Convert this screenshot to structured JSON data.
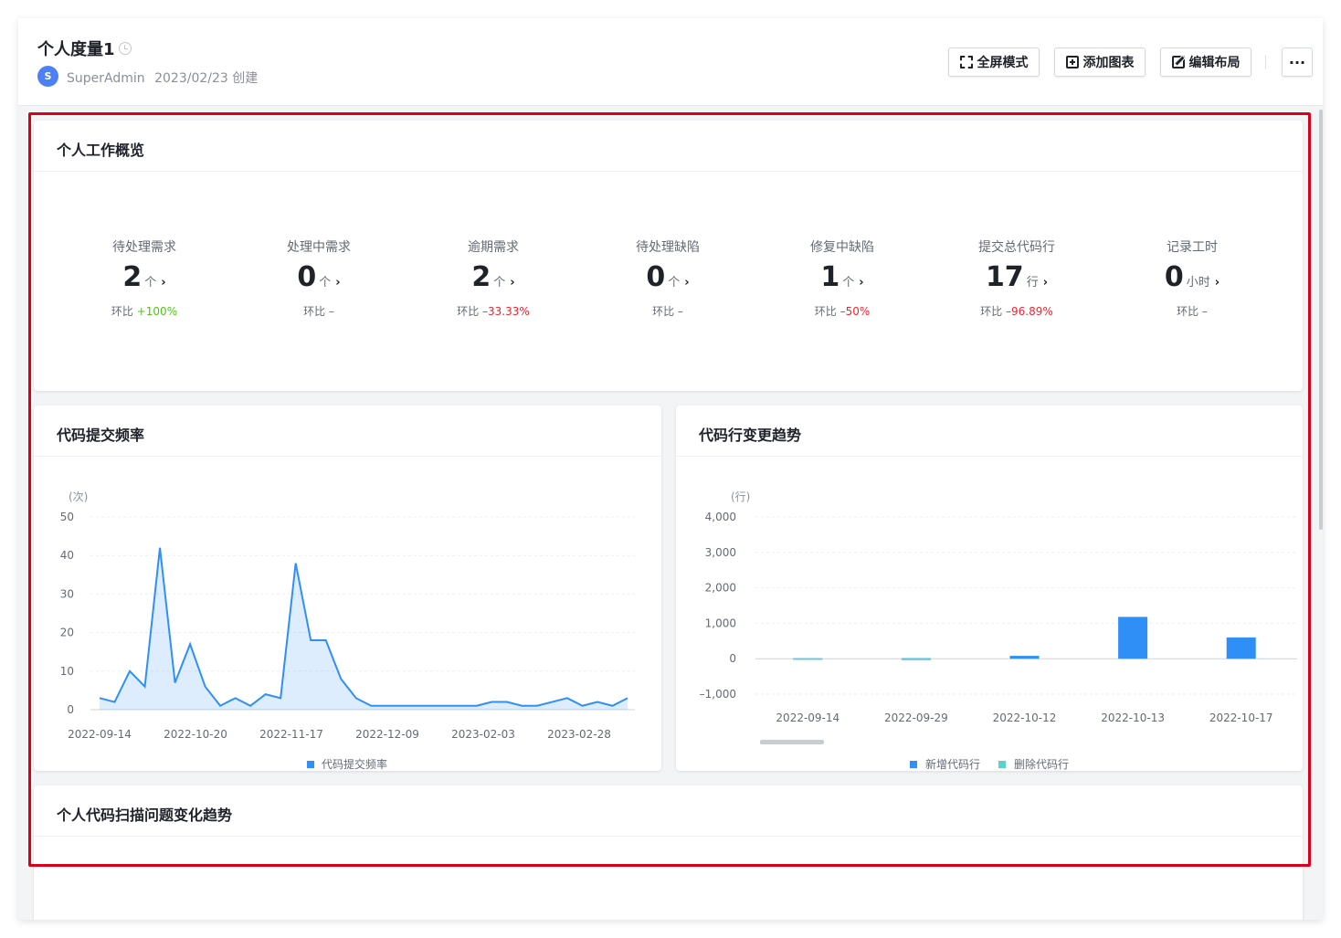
{
  "header": {
    "title": "个人度量1",
    "avatar_letter": "S",
    "user": "SuperAdmin",
    "created": "2023/02/23 创建",
    "buttons": {
      "fullscreen": "全屏模式",
      "add_chart": "添加图表",
      "edit_layout": "编辑布局",
      "more": "···"
    }
  },
  "overview": {
    "title": "个人工作概览",
    "ratio_label": "环比",
    "metrics": [
      {
        "label": "待处理需求",
        "value": "2",
        "unit": "个",
        "ratio": "+100%",
        "trend": "up"
      },
      {
        "label": "处理中需求",
        "value": "0",
        "unit": "个",
        "ratio": "–",
        "trend": "none"
      },
      {
        "label": "逾期需求",
        "value": "2",
        "unit": "个",
        "ratio": "–33.33%",
        "trend": "down"
      },
      {
        "label": "待处理缺陷",
        "value": "0",
        "unit": "个",
        "ratio": "–",
        "trend": "none"
      },
      {
        "label": "修复中缺陷",
        "value": "1",
        "unit": "个",
        "ratio": "–50%",
        "trend": "down"
      },
      {
        "label": "提交总代码行",
        "value": "17",
        "unit": "行",
        "ratio": "–96.89%",
        "trend": "down"
      },
      {
        "label": "记录工时",
        "value": "0",
        "unit": "小时",
        "ratio": "–",
        "trend": "none"
      }
    ]
  },
  "commit_card": {
    "title": "代码提交频率"
  },
  "lines_card": {
    "title": "代码行变更趋势"
  },
  "scan_card": {
    "title": "个人代码扫描问题变化趋势"
  },
  "chart_data": [
    {
      "type": "area",
      "title": "代码提交频率",
      "ylabel": "(次)",
      "ylim": [
        0,
        50
      ],
      "yticks": [
        0,
        10,
        20,
        30,
        40,
        50
      ],
      "x_tick_labels": [
        "2022-09-14",
        "2022-10-20",
        "2022-11-17",
        "2022-12-09",
        "2023-02-03",
        "2023-02-28"
      ],
      "grid": true,
      "legend_position": "bottom",
      "series": [
        {
          "name": "代码提交频率",
          "color": "#2f8ff7",
          "values": [
            3,
            2,
            10,
            6,
            42,
            7,
            17,
            6,
            1,
            3,
            1,
            4,
            3,
            38,
            18,
            18,
            8,
            3,
            1,
            1,
            1,
            1,
            1,
            1,
            1,
            1,
            2,
            2,
            1,
            1,
            2,
            3,
            1,
            2,
            1,
            3
          ]
        }
      ]
    },
    {
      "type": "bar",
      "title": "代码行变更趋势",
      "ylabel": "(行)",
      "ylim": [
        -1000,
        4000
      ],
      "yticks": [
        -1000,
        0,
        1000,
        2000,
        3000,
        4000
      ],
      "ytick_labels": [
        "–1,000",
        "0",
        "1,000",
        "2,000",
        "3,000",
        "4,000"
      ],
      "categories": [
        "2022-09-14",
        "2022-09-29",
        "2022-10-12",
        "2022-10-13",
        "2022-10-17"
      ],
      "grid": true,
      "legend_position": "bottom",
      "series": [
        {
          "name": "新增代码行",
          "color": "#2f8ff7",
          "values": [
            10,
            5,
            80,
            1180,
            600
          ]
        },
        {
          "name": "删除代码行",
          "color": "#5ed0c8",
          "values": [
            15,
            20,
            0,
            0,
            0
          ]
        }
      ]
    }
  ]
}
